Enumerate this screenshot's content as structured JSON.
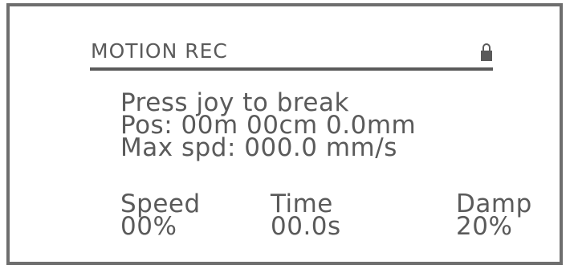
{
  "header": {
    "title": "MOTION REC",
    "lock_icon": "lock-icon"
  },
  "messages": [
    "Press joy to break",
    "Pos: 00m 00cm 0.0mm",
    "Max spd: 000.0 mm/s"
  ],
  "stats": [
    {
      "label": "Speed",
      "value": "00%"
    },
    {
      "label": "Time",
      "value": "00.0s"
    },
    {
      "label": "Damp",
      "value": "20%"
    }
  ],
  "colors": {
    "text": "#5a5a5a",
    "frame": "#6e6e6e",
    "background": "#ffffff"
  }
}
